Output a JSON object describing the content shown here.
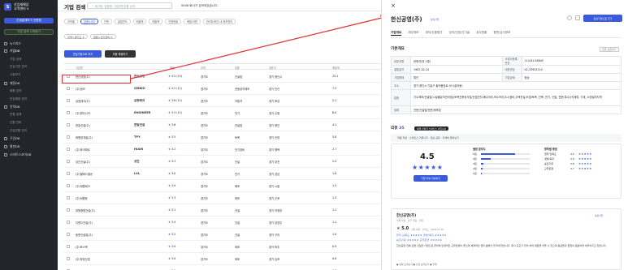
{
  "sidebar": {
    "brand": "산업재해감\n고객센터 v",
    "btn1": "선생결재하기 전환한",
    "btn2": "기업 검색 시작하기",
    "items": [
      {
        "label": "뉴스피드",
        "sub": false
      },
      {
        "label": "기업DB",
        "sub": false,
        "active": true
      },
      {
        "label": "기업 검색",
        "sub": true
      },
      {
        "label": "관심기업 관리",
        "sub": true
      },
      {
        "label": "시장보기",
        "sub": true
      },
      {
        "label": "재정DB",
        "sub": false
      },
      {
        "label": "회원 검색",
        "sub": true
      },
      {
        "label": "관심재정 관리",
        "sub": true
      },
      {
        "label": "인력DB",
        "sub": false
      },
      {
        "label": "인원 검색",
        "sub": true
      },
      {
        "label": "인원 관리",
        "sub": true
      },
      {
        "label": "관심인원 관리",
        "sub": true
      },
      {
        "label": "구인DB",
        "sub": false
      },
      {
        "label": "평판DB",
        "sub": false
      },
      {
        "label": "스마트스코어DB",
        "sub": false
      }
    ]
  },
  "main": {
    "title": "기업 검색",
    "search_placeholder": "회사명, 업종명, 사업자번호를 검색",
    "notice": "9408 회사가 검색되었습니다.",
    "filters": [
      "지역별",
      "업종&규모",
      "인원",
      "설립연도",
      "매출액",
      "매출액",
      "인원현황",
      "매출/지원",
      "관리자/최신 내 정보관리"
    ],
    "tags": [
      "지역＞경기도 ×",
      "업종＞전기장비 ×"
    ],
    "add_btn": "관심기업으로 추가",
    "sort_btn": "최종 확정하기",
    "columns": [
      "기업명",
      "평점",
      "지역",
      "업종",
      "대표자",
      "매출액"
    ],
    "rows": [
      {
        "name": "한신공영(주)",
        "logo": "한신공영",
        "rating": "4.5 (15)",
        "region": "경기도",
        "type": "건설업",
        "ceo": "경기 용인시",
        "sales": "15.1"
      },
      {
        "name": "(주)센코",
        "logo": "SENKO",
        "rating": "4.2 (11)",
        "region": "경기도",
        "type": "전동장치제조",
        "ceo": "경기 안산",
        "sales": "7.2"
      },
      {
        "name": "삼정테크(주)",
        "logo": "삼정테크",
        "rating": "3.6 (11)",
        "region": "경기도",
        "type": "자동차",
        "ceo": "경기 화성",
        "sales": "2.1"
      },
      {
        "name": "(주)엔지니어",
        "logo": "ENGINEER",
        "rating": "3.3 (11)",
        "region": "경기도",
        "type": "전기",
        "ceo": "경기 수원",
        "sales": "6.0"
      },
      {
        "name": "한일건설(주)",
        "logo": "한일건설",
        "rating": "3.6",
        "region": "경기도",
        "type": "건설업",
        "ceo": "경기 용인",
        "sales": "4.1"
      },
      {
        "name": "태평양개발(주)",
        "logo": "TPY",
        "rating": "3.5",
        "region": "경기도",
        "type": "토목",
        "ceo": "경기 안양",
        "sales": "5.8"
      },
      {
        "name": "(주)하이에르",
        "logo": "HIAIR",
        "rating": "3.2",
        "region": "경기도",
        "type": "전기장비",
        "ceo": "경기 평택",
        "sales": "2.7"
      },
      {
        "name": "성진건설(주)",
        "logo": "성진",
        "rating": "3.3",
        "region": "경기도",
        "type": "건설",
        "ceo": "경기 부천",
        "sales": "2.4"
      },
      {
        "name": "(주)엘에스엘공",
        "logo": "LSL",
        "rating": "3.0",
        "region": "경기도",
        "type": "전기",
        "ceo": "경기 성남",
        "sales": "1.8"
      },
      {
        "name": "(주)대원테크",
        "logo": "",
        "rating": "3.0",
        "region": "경기도",
        "type": "제조",
        "ceo": "경기 시흥",
        "sales": "1.5"
      },
      {
        "name": "(주)대평한",
        "logo": "",
        "rating": "3.3",
        "region": "경기도",
        "type": "제조",
        "ceo": "경기 군포",
        "sales": "1.3"
      },
      {
        "name": "대원종합건설(주)",
        "logo": "",
        "rating": "3.1",
        "region": "경기도",
        "type": "건설",
        "ceo": "경기 의정부",
        "sales": "1.2"
      },
      {
        "name": "디엔디건설(주)",
        "logo": "",
        "rating": "3.4",
        "region": "경기도",
        "type": "건설",
        "ceo": "경기 남양주",
        "sales": "1.1"
      },
      {
        "name": "동명건설업(주)",
        "logo": "",
        "rating": "3.2",
        "region": "경기도",
        "type": "건설",
        "ceo": "경기 구리",
        "sales": "1.0"
      },
      {
        "name": "(주)포스텍",
        "logo": "",
        "rating": "3.0",
        "region": "경기도",
        "type": "제조",
        "ceo": "경기 파주",
        "sales": "0.9"
      },
      {
        "name": "(주)부장산업",
        "logo": "",
        "rating": "3.0",
        "region": "경기도",
        "type": "제조",
        "ceo": "경기 김포",
        "sales": "0.8"
      },
      {
        "name": "(주)엘에이치",
        "logo": "",
        "rating": "3.1",
        "region": "경기도",
        "type": "제조",
        "ceo": "경기 광주",
        "sales": "0.7"
      }
    ]
  },
  "panel": {
    "close": "×",
    "name": "한신공영(주)",
    "name_badge": "상장기업",
    "follow_btn": "관심기업으로 추가",
    "tabs": [
      "기업개요",
      "재무정보",
      "재직/신용평가",
      "임직/인정/신기술",
      "공사현황",
      "평판/심사정보"
    ],
    "overview_title": "기본개요",
    "overview_link": "요청 보완하기",
    "info": [
      [
        "대표자명",
        "한채석(외 2명)",
        "사업자등록번호",
        "114-81-94605"
      ],
      [
        "설립일자",
        "1967-02-24",
        "대표번호",
        "02-33933114"
      ],
      [
        "기업형태",
        "법인",
        "기업상태",
        "정상"
      ],
      [
        "주소",
        "경기 용인시 기흥구 흥덕중앙로 93 (흥덕동)",
        "",
        ""
      ],
      [
        "업종",
        "기수제조/건설업(시설물유지관리업)/토목건축공사업/산업단지,폐수처리,하수처리,도시정비,주택건설,조경/토목, 건축, 전기, 산업, 전문(특수)/석재류, 기계, 소방설치지역",
        "",
        ""
      ],
      [
        "업태",
        "전문/건설업/전문/제조업",
        "",
        ""
      ]
    ],
    "review_title": "리뷰",
    "review_count": "35",
    "review_badge": "체결 간편한 스마트스 커뮤니티",
    "review_banner": "직원 작성 · 스마트스 커뮤니티 · 정보 공유 · 자세히 알아보기",
    "score": "4.5",
    "score_stars": "★★★★★",
    "write_btn": "기업 리뷰 작성하기",
    "bars_title": "별점 분포도",
    "bars": [
      {
        "label": "5점",
        "pct": 70
      },
      {
        "label": "4점",
        "pct": 20
      },
      {
        "label": "3점",
        "pct": 5
      },
      {
        "label": "2점",
        "pct": 3
      },
      {
        "label": "1점",
        "pct": 2
      }
    ],
    "cat_title": "항목별 평점",
    "cats": [
      {
        "label": "업무 만족도",
        "val": "4.5"
      },
      {
        "label": "경영/복지",
        "val": "3.9"
      },
      {
        "label": "승진기회",
        "val": "3.8"
      },
      {
        "label": "근무환경",
        "val": "3.7"
      }
    ],
    "card_name": "한신공영(주)",
    "card_sub": "직원 작성 · 근무 인증 · 현재",
    "card_badge": "상장기업",
    "card_score": "5.0",
    "card_meta": "직원 대면 · 경기도 · 2024.07.22",
    "card_row1": "업무 만족도 ★★★★★  경영/복지 ★★★★★",
    "card_row2": "승진기회 ★★★★★  근무환경 ★★★★★",
    "card_text": "한신공영 전체 모범 건실한 기업으로 꼽히며 안정적인 근무환경이 좋으며 체계적인 업무 분배가 잘 되어있습니다. 회사 규모가 있어 여러 경험을 쌓을 수 있으며 동료들과 협업이 원활하게 이루어지고 있습니다.",
    "card_pros": "● 장점 모아보기  ● 단점 모아보기  ● 전체"
  },
  "colors": {
    "accent": "#3b5bdb",
    "sidebar": "#23252b",
    "highlight": "#e03131"
  }
}
